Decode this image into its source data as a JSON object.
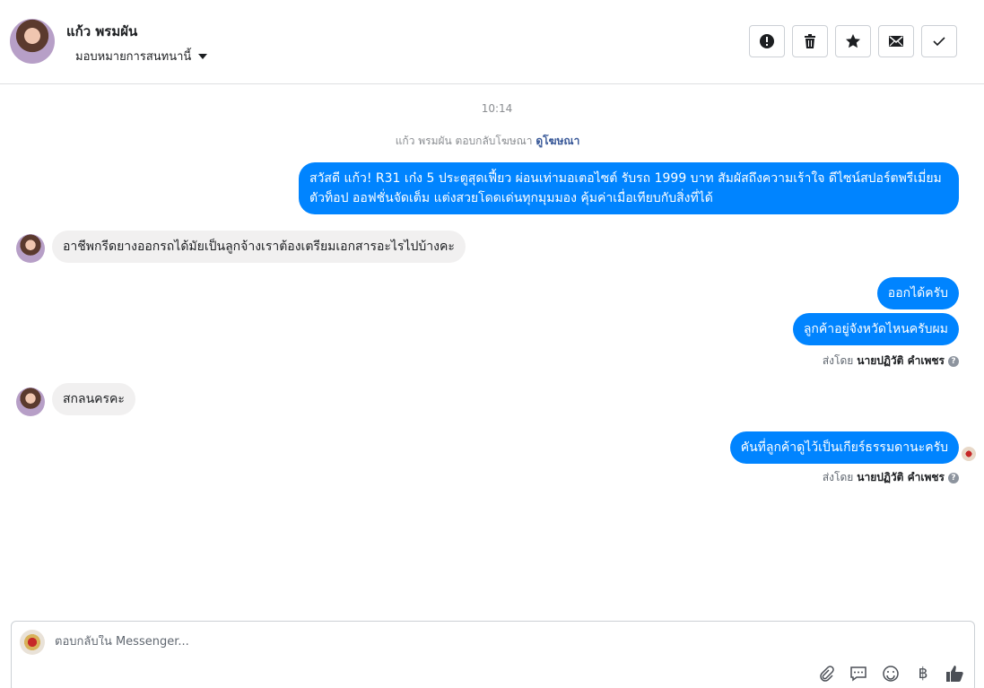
{
  "header": {
    "contact_name": "แก้ว พรมผัน",
    "assign_label": "มอบหมายการสนทนานี้",
    "actions": [
      "spam-icon",
      "trash-icon",
      "star-icon",
      "mail-icon",
      "check-icon"
    ]
  },
  "thread": {
    "time": "10:14",
    "ad_reply_text": "แก้ว พรมผัน ตอบกลับโฆษณา",
    "ad_link": "ดูโฆษณา",
    "messages": [
      {
        "direction": "out",
        "text": "สวัสดี แก้ว! R31 เก๋ง 5 ประตูสุดเฟี้ยว ผ่อนเท่ามอเตอไซต์ รับรถ 1999 บาท สัมผัสถึงความเร้าใจ ดีไซน์สปอร์ตพรีเมี่ยม ตัวท็อป ออฟชั่นจัดเต็ม แต่งสวยโดดเด่นทุกมุมมอง คุ้มค่าเมื่อเทียบกับสิ่งที่ได้"
      },
      {
        "direction": "in",
        "text": "อาชีพกรีดยางออกรถได้มัยเป็นลูกจ้างเราต้องเตรียมเอกสารอะไรไปบ้างคะ"
      },
      {
        "direction": "out",
        "text": "ออกได้ครับ"
      },
      {
        "direction": "out",
        "text": "ลูกค้าอยู่จังหวัดไหนครับผม"
      },
      {
        "direction": "in",
        "text": "สกลนครคะ"
      },
      {
        "direction": "out",
        "text": "คันที่ลูกค้าดูไว้เป็นเกียร์ธรรมดานะครับ"
      }
    ],
    "sent_by_label": "ส่งโดย",
    "sent_by_name": "นายปฏิวัติ คำเพชร"
  },
  "composer": {
    "placeholder": "ตอบกลับใน Messenger...",
    "icons": [
      "attach-icon",
      "quick-reply-icon",
      "emoji-icon",
      "baht-icon",
      "like-icon"
    ]
  },
  "colors": {
    "outgoing": "#0084ff",
    "incoming": "#f1f0f0",
    "link": "#385898"
  }
}
